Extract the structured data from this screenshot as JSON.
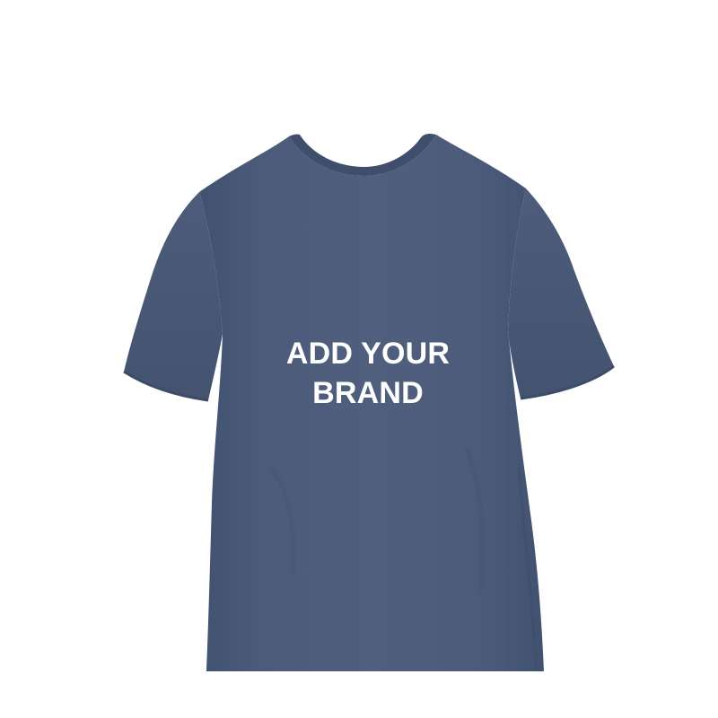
{
  "product": {
    "garment": "t-shirt",
    "colors": {
      "background": "#ffffff",
      "shirt": "#4a5a78",
      "shirt_shadow": "#3e4d69",
      "shirt_highlight": "#566886",
      "collar": "#485877",
      "text": "#ffffff"
    },
    "print_text": {
      "line1": "ADD YOUR",
      "line2": "BRAND"
    }
  }
}
